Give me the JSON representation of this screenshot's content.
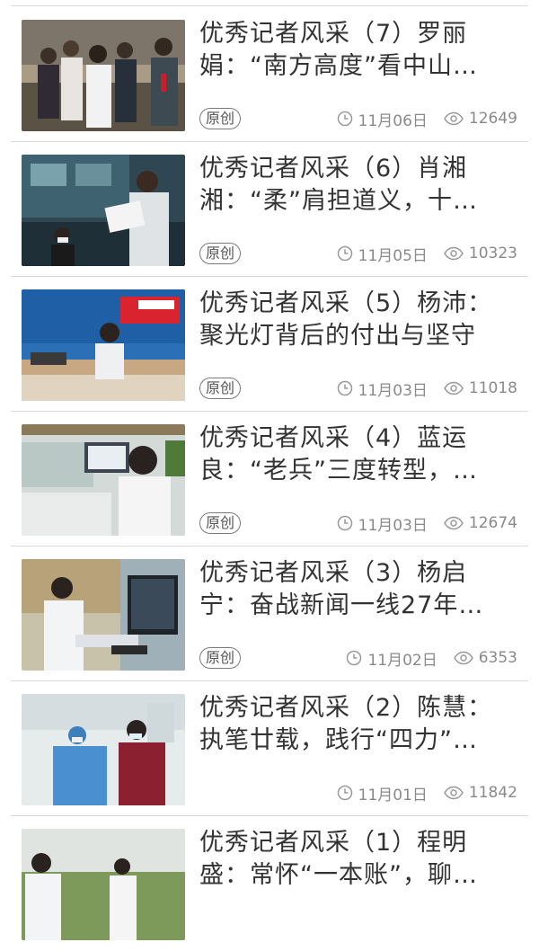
{
  "articles": [
    {
      "title": "优秀记者风采（7）罗丽娟：“南方高度”看中山…",
      "badge": "原创",
      "date": "11月06日",
      "views": "12649",
      "thumb_bg": "#b9a88f"
    },
    {
      "title": "优秀记者风采（6）肖湘湘：“柔”肩担道义，十…",
      "badge": "原创",
      "date": "11月05日",
      "views": "10323",
      "thumb_bg": "#2d4a5a"
    },
    {
      "title": "优秀记者风采（5）杨沛：聚光灯背后的付出与坚守",
      "badge": "原创",
      "date": "11月03日",
      "views": "11018",
      "thumb_bg": "#3a7fc0"
    },
    {
      "title": "优秀记者风采（4）蓝运良：“老兵”三度转型，…",
      "badge": "原创",
      "date": "11月03日",
      "views": "12674",
      "thumb_bg": "#cfd6d4"
    },
    {
      "title": "优秀记者风采（3）杨启宁：奋战新闻一线27年…",
      "badge": "原创",
      "date": "11月02日",
      "views": "6353",
      "thumb_bg": "#a9b8b0"
    },
    {
      "title": "优秀记者风采（2）陈慧：执笔廿载，践行“四力”…",
      "badge": "",
      "date": "11月01日",
      "views": "11842",
      "thumb_bg": "#e9eef0"
    },
    {
      "title": "优秀记者风采（1）程明盛：常怀“一本账”，聊…",
      "badge": "",
      "date": "",
      "views": "",
      "thumb_bg": "#c8d2c4"
    }
  ]
}
